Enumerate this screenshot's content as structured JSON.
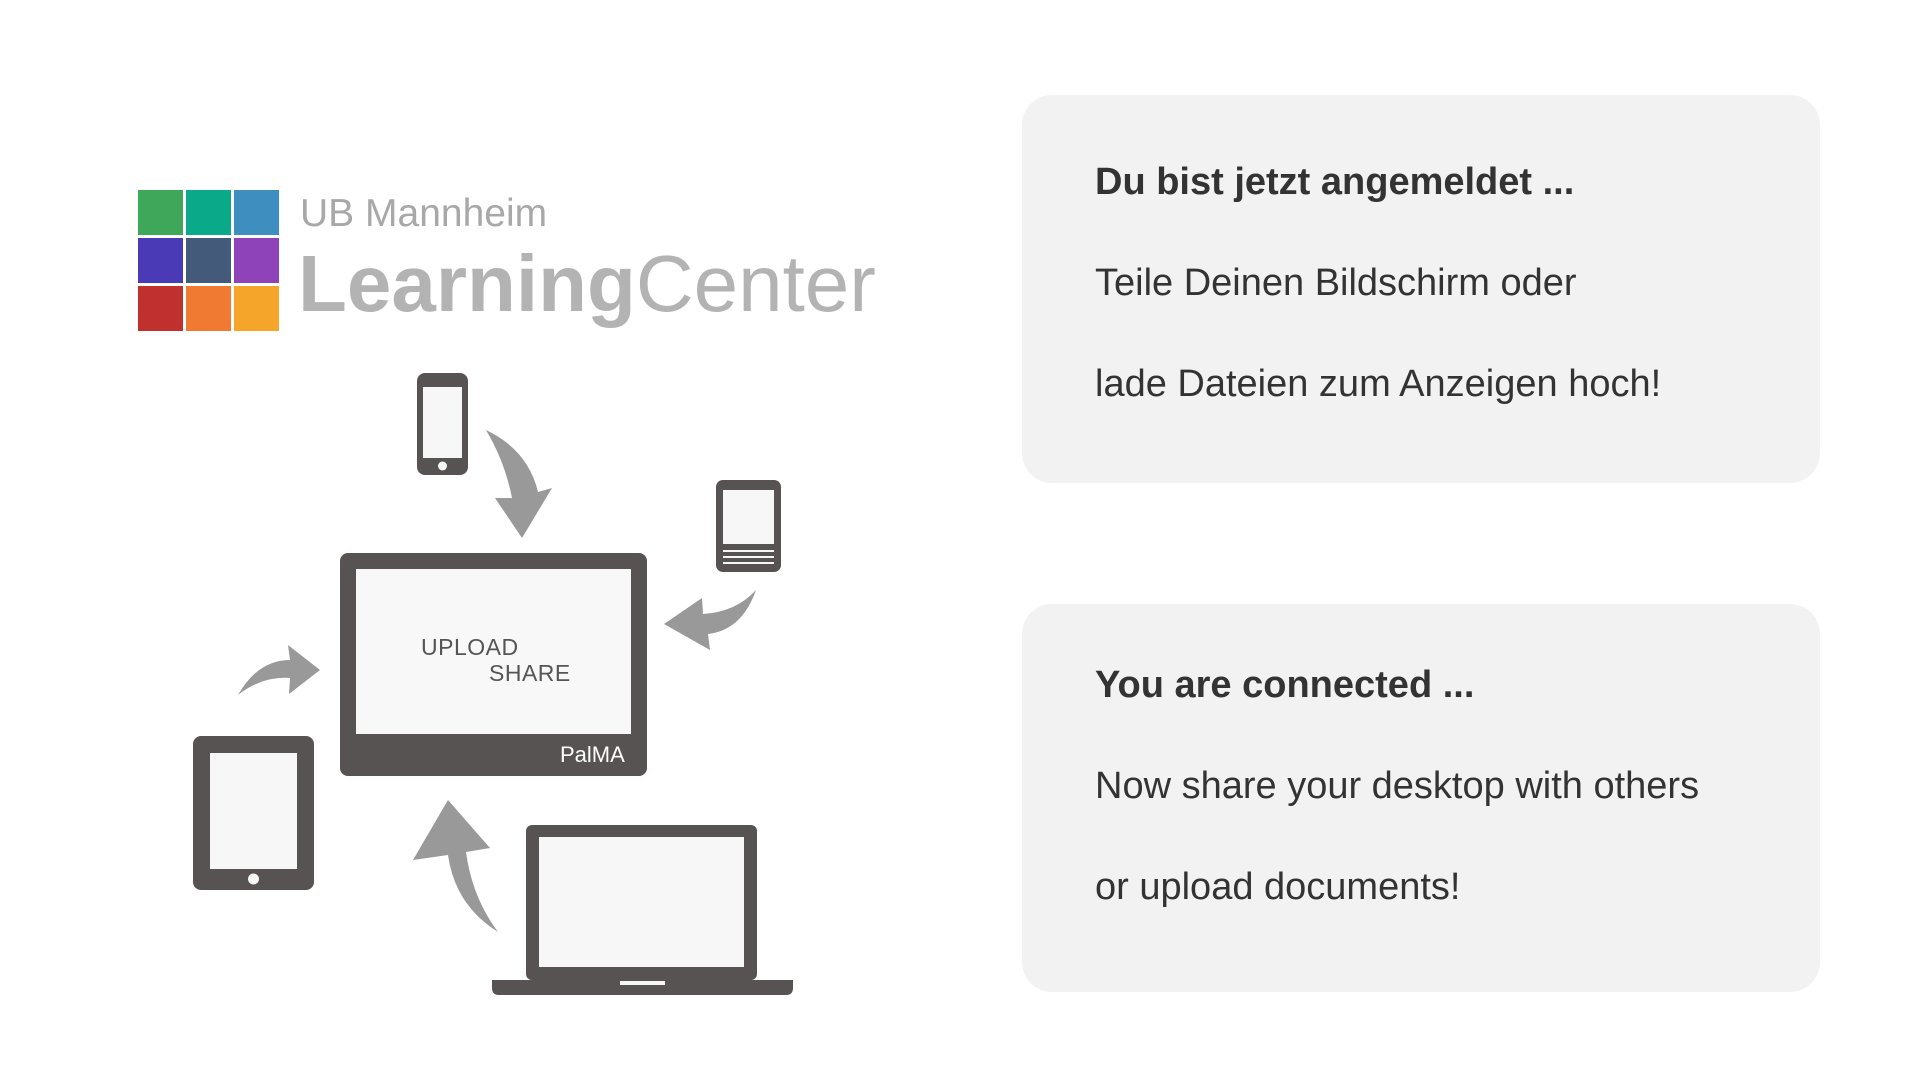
{
  "logo": {
    "subtitle": "UB Mannheim",
    "title_bold": "Learning",
    "title_light": "Center",
    "tile_colors": [
      "#3fa75a",
      "#0aa98a",
      "#3e8ebf",
      "#4a3ab5",
      "#435a7a",
      "#8e44b8",
      "#c0302f",
      "#f07a32",
      "#f5a52a"
    ]
  },
  "illustration": {
    "upload_label": "UPLOAD",
    "share_label": "SHARE",
    "brand_label": "PalMA",
    "device_color": "#575352",
    "arrow_color": "#999999"
  },
  "card_de": {
    "title": "Du bist jetzt angemeldet ...",
    "line1": "Teile Deinen Bildschirm oder",
    "line2": "lade Dateien zum Anzeigen hoch!"
  },
  "card_en": {
    "title": "You are connected ...",
    "line1": "Now share your desktop with others",
    "line2": "or upload documents!"
  }
}
